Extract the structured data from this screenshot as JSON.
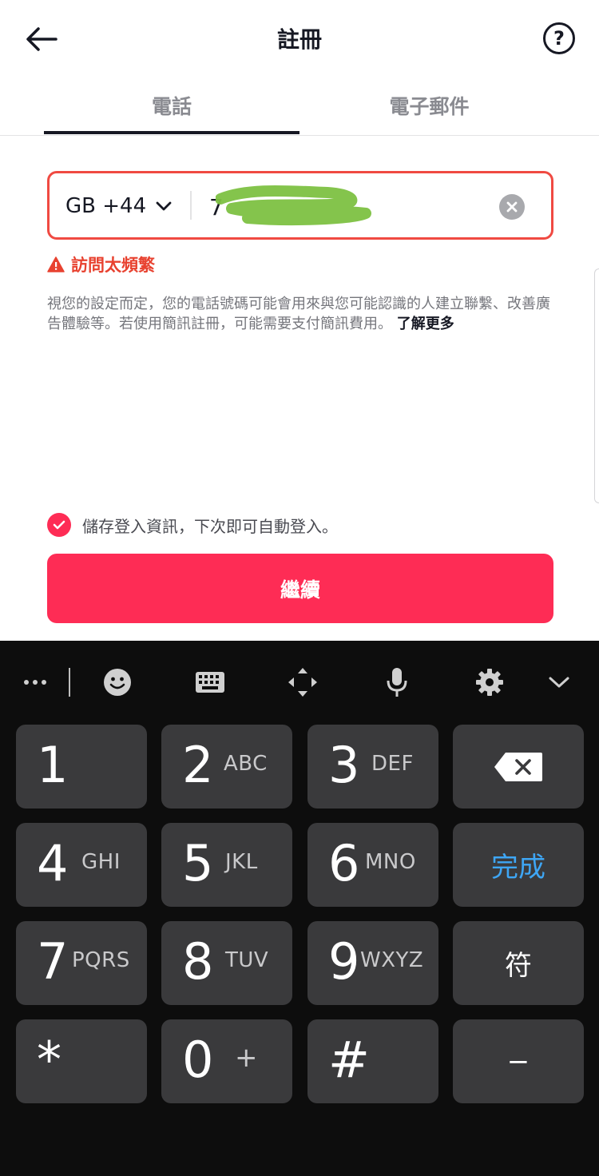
{
  "header": {
    "title": "註冊",
    "help_label": "?"
  },
  "tabs": [
    {
      "label": "電話"
    },
    {
      "label": "電子郵件"
    }
  ],
  "phone": {
    "country_code": "GB +44",
    "value": "7"
  },
  "error": {
    "text": "訪問太頻繁"
  },
  "disclaimer": {
    "text": "視您的設定而定，您的電話號碼可能會用來與您可能認識的人建立聯繫、改善廣告體驗等。若使用簡訊註冊，可能需要支付簡訊費用。",
    "link": "了解更多"
  },
  "save_login": {
    "text": "儲存登入資訊，下次即可自動登入。",
    "checked": true
  },
  "continue_button": {
    "label": "繼續"
  },
  "colors": {
    "accent": "#fe2c55",
    "error": "#e84230",
    "done_key": "#3ea6f5"
  },
  "keyboard": {
    "toolbar_icons": [
      "more-icon",
      "emoji-icon",
      "keyboard-icon",
      "move-cursor-icon",
      "microphone-icon",
      "settings-icon",
      "collapse-chevron-icon"
    ],
    "keys": [
      {
        "num": "1",
        "letters": ""
      },
      {
        "num": "2",
        "letters": "ABC"
      },
      {
        "num": "3",
        "letters": "DEF"
      },
      {
        "num": "4",
        "letters": "GHI"
      },
      {
        "num": "5",
        "letters": "JKL"
      },
      {
        "num": "6",
        "letters": "MNO"
      },
      {
        "num": "7",
        "letters": "PQRS"
      },
      {
        "num": "8",
        "letters": "TUV"
      },
      {
        "num": "9",
        "letters": "WXYZ"
      },
      {
        "num": "*",
        "letters": ""
      },
      {
        "num": "0",
        "letters": "+"
      },
      {
        "num": "#",
        "letters": ""
      }
    ],
    "done_label": "完成",
    "symbols_label": "符",
    "minus_label": "−"
  }
}
